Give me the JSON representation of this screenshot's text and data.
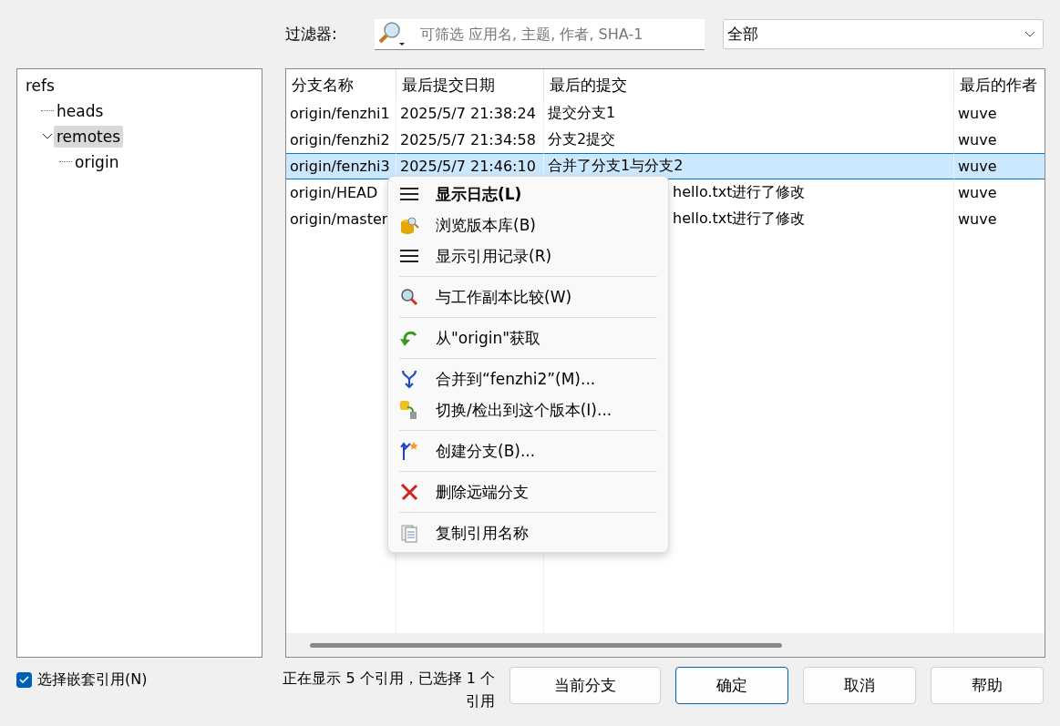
{
  "filter": {
    "label": "过滤器:",
    "placeholder": "可筛选 应用名, 主题, 作者, SHA-1",
    "scope": "全部"
  },
  "tree": [
    {
      "label": "refs",
      "selected": false,
      "children": [
        {
          "label": "heads",
          "selected": false
        },
        {
          "label": "remotes",
          "selected": true,
          "expanded": true,
          "children": [
            {
              "label": "origin",
              "selected": false
            }
          ]
        }
      ]
    }
  ],
  "table": {
    "columns": [
      "分支名称",
      "最后提交日期",
      "最后的提交",
      "最后的作者"
    ],
    "rows": [
      {
        "selected": false,
        "cells": [
          {
            "text": "origin/fenzhi1"
          },
          {
            "text": "2025/5/7 21:38:24"
          },
          {
            "text": "提交分支1"
          },
          {
            "text": "wuve"
          }
        ]
      },
      {
        "selected": false,
        "cells": [
          {
            "text": "origin/fenzhi2"
          },
          {
            "text": "2025/5/7 21:34:58"
          },
          {
            "text": "分支2提交"
          },
          {
            "text": "wuve"
          }
        ]
      },
      {
        "selected": true,
        "cells": [
          {
            "text": "origin/fenzhi3"
          },
          {
            "text": "2025/5/7 21:46:10"
          },
          {
            "text": "合并了分支1与分支2"
          },
          {
            "text": "wuve"
          }
        ]
      },
      {
        "selected": false,
        "cells": [
          {
            "text": "origin/HEAD"
          },
          {
            "kind": "hidden"
          },
          {
            "text": "hello.txt进行了修改",
            "kind": "partial"
          },
          {
            "text": "wuve"
          }
        ]
      },
      {
        "selected": false,
        "cells": [
          {
            "text": "origin/master"
          },
          {
            "kind": "hidden"
          },
          {
            "text": "hello.txt进行了修改",
            "kind": "partial"
          },
          {
            "text": "wuve"
          }
        ]
      }
    ]
  },
  "menu": [
    {
      "kind": "item",
      "label": "显示日志(L)",
      "default": true
    },
    {
      "kind": "item",
      "label": "浏览版本库(B)",
      "default": false
    },
    {
      "kind": "item",
      "label": "显示引用记录(R)",
      "default": false
    },
    {
      "kind": "separator"
    },
    {
      "kind": "item",
      "label": "与工作副本比较(W)",
      "default": false
    },
    {
      "kind": "separator"
    },
    {
      "kind": "item",
      "label": "从\"origin\"获取",
      "default": false
    },
    {
      "kind": "separator"
    },
    {
      "kind": "item",
      "label": "合并到“fenzhi2”(M)...",
      "default": false
    },
    {
      "kind": "item",
      "label": "切换/检出到这个版本(I)...",
      "default": false
    },
    {
      "kind": "separator"
    },
    {
      "kind": "item",
      "label": "创建分支(B)...",
      "default": false
    },
    {
      "kind": "separator"
    },
    {
      "kind": "item",
      "label": "删除远端分支",
      "default": false
    },
    {
      "kind": "separator"
    },
    {
      "kind": "item",
      "label": "复制引用名称",
      "default": false
    }
  ],
  "nested": {
    "label": "选择嵌套引用(N)",
    "checked": true
  },
  "status": "正在显示 5 个引用，已选择 1 个引用",
  "buttons": [
    {
      "label": "当前分支",
      "default": false
    },
    {
      "label": "确定",
      "default": true
    },
    {
      "label": "取消",
      "default": false
    },
    {
      "label": "帮助",
      "default": false
    }
  ]
}
